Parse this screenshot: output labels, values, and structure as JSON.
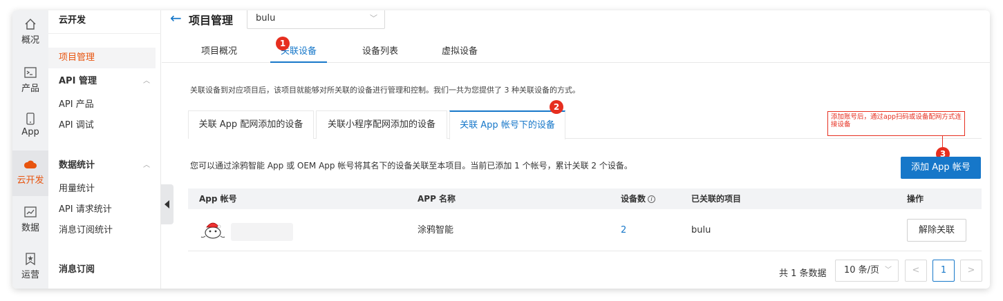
{
  "rail": {
    "items": [
      {
        "label": "概况",
        "icon": "home-icon"
      },
      {
        "label": "产品",
        "icon": "terminal-icon"
      },
      {
        "label": "App",
        "icon": "phone-icon"
      },
      {
        "label": "云开发",
        "icon": "cloud-icon"
      },
      {
        "label": "数据",
        "icon": "chart-icon"
      },
      {
        "label": "运营",
        "icon": "bookmark-star-icon"
      }
    ]
  },
  "sidebar": {
    "brand": "云开发",
    "items": {
      "project_mgmt": "项目管理",
      "api_group": "API 管理",
      "api_product": "API 产品",
      "api_debug": "API 调试",
      "stats_group": "数据统计",
      "usage_stats": "用量统计",
      "api_req_stats": "API 请求统计",
      "msg_sub_stats": "消息订阅统计",
      "msg_sub_group": "消息订阅"
    }
  },
  "header": {
    "title": "项目管理",
    "project_select": "bulu"
  },
  "top_tabs": [
    "项目概况",
    "关联设备",
    "设备列表",
    "虚拟设备"
  ],
  "description": "关联设备到对应项目后，该项目就能够对所关联的设备进行管理和控制。我们一共为您提供了 3 种关联设备的方式。",
  "sub_tabs": [
    "关联 App 配网添加的设备",
    "关联小程序配网添加的设备",
    "关联 App 帐号下的设备"
  ],
  "annotation": {
    "badges": [
      "1",
      "2",
      "3"
    ],
    "note": "添加账号后，通过app扫码或设备配网方式连接设备"
  },
  "info_text": "您可以通过涂鸦智能 App 或 OEM App 帐号将其名下的设备关联至本项目。当前已添加 1 个帐号，累计关联 2 个设备。",
  "add_button": "添加 App 帐号",
  "table": {
    "headers": {
      "account": "App 帐号",
      "app_name": "APP 名称",
      "devices": "设备数",
      "projects": "已关联的项目",
      "actions": "操作"
    },
    "rows": [
      {
        "app_name": "涂鸦智能",
        "devices": "2",
        "project": "bulu",
        "action": "解除关联"
      }
    ]
  },
  "pagination": {
    "total": "共 1 条数据",
    "page_size": "10 条/页",
    "prev": "<",
    "current": "1",
    "next": ">"
  },
  "colors": {
    "accent": "#1677c9",
    "active_orange": "#e8540e",
    "annotation_red": "#e62e1f"
  }
}
